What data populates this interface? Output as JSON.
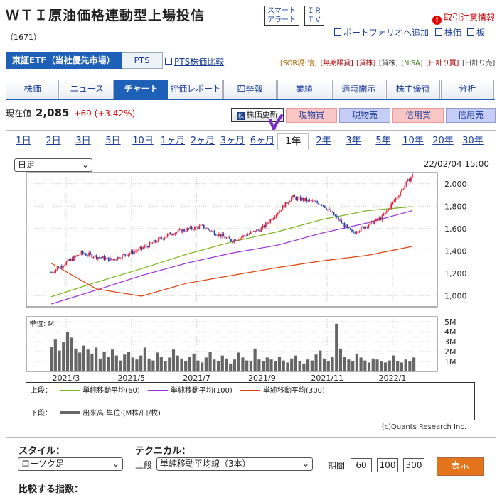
{
  "header": {
    "title": "ＷＴＩ原油価格連動型上場投信",
    "code": "（1671）",
    "smart_alert": [
      "スマート",
      "アラート"
    ],
    "ir_tv": [
      "ＩＲ",
      "ＴＶ"
    ],
    "alert_label": "取引注意情報",
    "add_portfolio": "ポートフォリオへ追加",
    "stock_price_link": "株価",
    "board_link": "板"
  },
  "market_tabs": {
    "primary": "東証ETF（当社優先市場）",
    "pts": "PTS",
    "compare": "PTS株価比較"
  },
  "tags": [
    "[SOR現･信]",
    "[無期限貸]",
    "[貸株]",
    "[貸株]",
    "[NISA]",
    "[日計り買]",
    "[日計り売]"
  ],
  "nav_tabs": [
    "株価",
    "ニュース",
    "チャート",
    "評価レポート",
    "四季報",
    "業績",
    "適時開示",
    "株主優待",
    "分析"
  ],
  "price": {
    "label": "現在値",
    "value": "2,085",
    "change": "+69 (+3.42%)"
  },
  "actions": {
    "update": "株価更新",
    "spot_buy": "現物買",
    "spot_sell": "現物売",
    "margin_buy": "信用買",
    "margin_sell": "信用売"
  },
  "periods": [
    "1日",
    "2日",
    "3日",
    "5日",
    "10日",
    "1ヶ月",
    "2ヶ月",
    "3ヶ月",
    "6ヶ月",
    "1年",
    "2年",
    "3年",
    "5年",
    "10年",
    "20年",
    "30年"
  ],
  "chart_controls": {
    "interval": "日足",
    "datetime": "22/02/04 15:00"
  },
  "chart_data": [
    {
      "type": "line",
      "title": "",
      "x": [
        "2021/3",
        "2021/5",
        "2021/7",
        "2021/9",
        "2021/11",
        "2022/1"
      ],
      "y_ticks": [
        "2,000",
        "1,800",
        "1,600",
        "1,400",
        "1,200",
        "1,000"
      ],
      "ylim": [
        900,
        2100
      ],
      "series": [
        {
          "name": "単純移動平均(60)",
          "color": "#7cb51e",
          "values": [
            990,
            1120,
            1240,
            1370,
            1480,
            1570,
            1680,
            1760,
            1795
          ]
        },
        {
          "name": "単純移動平均(100)",
          "color": "#9a2cd8",
          "values": [
            925,
            1050,
            1180,
            1290,
            1380,
            1450,
            1560,
            1650,
            1760
          ]
        },
        {
          "name": "単純移動平均(300)",
          "color": "#e0400e",
          "values": [
            1290,
            1060,
            995,
            1110,
            1180,
            1250,
            1310,
            1360,
            1440
          ]
        },
        {
          "name": "close",
          "color": "#d00",
          "values": [
            1210,
            1380,
            1320,
            1420,
            1560,
            1620,
            1490,
            1600,
            1880,
            1820,
            1560,
            1700,
            2080
          ]
        }
      ]
    },
    {
      "type": "bar",
      "unit_label": "単位: M",
      "y_ticks": [
        "5M",
        "4M",
        "3M",
        "2M",
        "1M"
      ],
      "ylim": [
        0,
        5.5
      ],
      "values": [
        2.5,
        3.2,
        2.1,
        3.0,
        4.0,
        3.4,
        2.3,
        1.9,
        2.6,
        2.2,
        1.8,
        2.4,
        1.3,
        2.0,
        1.5,
        2.2,
        1.6,
        1.1,
        1.7,
        2.0,
        1.4,
        1.2,
        1.6,
        2.4,
        1.3,
        1.1,
        1.9,
        1.5,
        1.0,
        1.4,
        2.2,
        1.6,
        1.3,
        1.0,
        1.5,
        1.8,
        1.1,
        0.9,
        1.4,
        2.0,
        1.2,
        1.0,
        1.6,
        1.3,
        0.8,
        1.2,
        1.9,
        1.4,
        1.1,
        1.0,
        2.3,
        1.2,
        1.0,
        1.4,
        1.2,
        1.0,
        1.5,
        1.1,
        0.9,
        1.3,
        1.6,
        1.0,
        0.8,
        1.2,
        1.1,
        1.7,
        2.1,
        1.3,
        1.0,
        1.5,
        4.8,
        2.3,
        1.5,
        1.2,
        1.0,
        1.8,
        1.4,
        1.1,
        0.9,
        1.3,
        1.2,
        1.0,
        0.9,
        1.1,
        1.6,
        1.0,
        0.9,
        1.2,
        1.0,
        1.4
      ]
    }
  ],
  "legend": {
    "upper_label": "上段：",
    "lower_label": "下段：",
    "volume_label": "出来高 単位:(M株/口/枚)"
  },
  "copyright": "(c)Quants Research Inc.",
  "form": {
    "style_label": "スタイル：",
    "style_value": "ローソク足",
    "tech_label": "テクニカル：",
    "upper_label": "上段",
    "tech_value": "単純移動平均線（3本）",
    "period_label": "期間",
    "p1": "60",
    "p2": "100",
    "p3": "300",
    "show": "表示",
    "compare_label": "比較する指数："
  }
}
